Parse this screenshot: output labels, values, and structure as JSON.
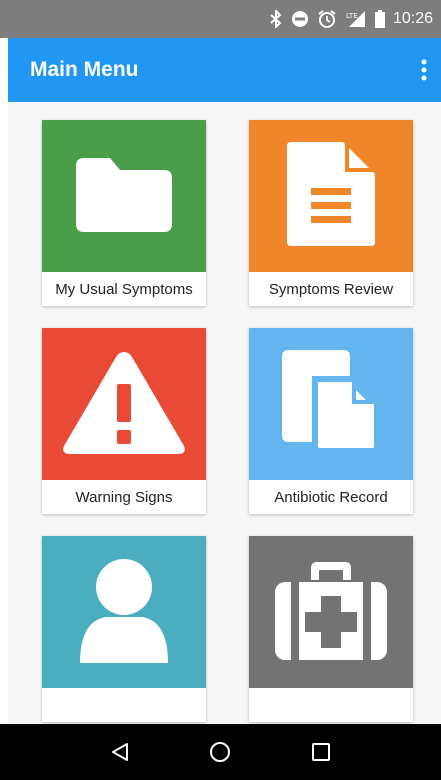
{
  "status_bar": {
    "time": "10:26",
    "icons": [
      "bluetooth-icon",
      "do-not-disturb-icon",
      "alarm-icon",
      "lte-signal-icon",
      "battery-icon"
    ],
    "network_label": "LTE"
  },
  "app_bar": {
    "title": "Main Menu",
    "overflow_icon": "more-vert-icon"
  },
  "colors": {
    "app_bar": "#2196f3",
    "status_bar": "#7d7d7d",
    "tile_green": "#4a9e4a",
    "tile_orange": "#f0862a",
    "tile_red": "#e84a35",
    "tile_blue": "#64b4f0",
    "tile_teal": "#4aaebe",
    "tile_gray": "#737373"
  },
  "tiles": [
    {
      "label": "My Usual Symptoms",
      "icon": "folder-icon"
    },
    {
      "label": "Symptoms Review",
      "icon": "document-icon"
    },
    {
      "label": "Warning Signs",
      "icon": "warning-icon"
    },
    {
      "label": "Antibiotic Record",
      "icon": "copy-document-icon"
    },
    {
      "label": "",
      "icon": "person-icon"
    },
    {
      "label": "",
      "icon": "medical-kit-icon"
    }
  ],
  "nav_bar": {
    "back_icon": "back-triangle-icon",
    "home_icon": "home-circle-icon",
    "recents_icon": "recents-square-icon"
  }
}
